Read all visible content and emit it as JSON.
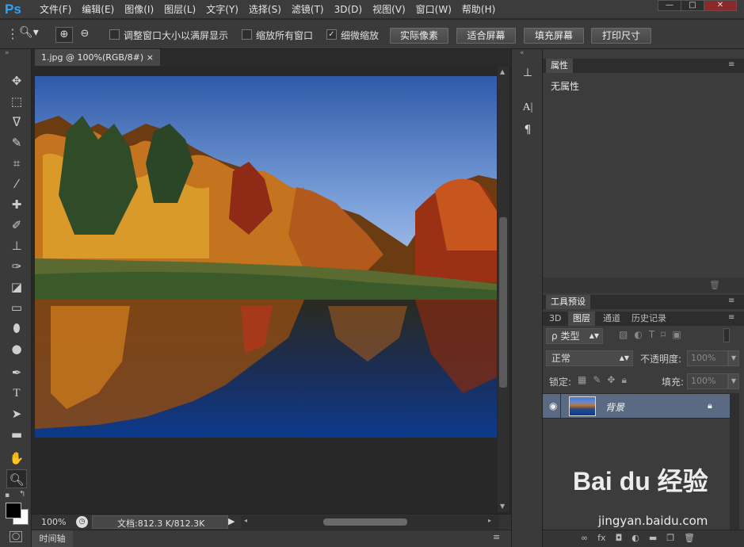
{
  "app": {
    "logo": "Ps"
  },
  "menu": [
    "文件(F)",
    "编辑(E)",
    "图像(I)",
    "图层(L)",
    "文字(Y)",
    "选择(S)",
    "滤镜(T)",
    "3D(D)",
    "视图(V)",
    "窗口(W)",
    "帮助(H)"
  ],
  "window_controls": {
    "minimize": "—",
    "restore": "□",
    "close": "✕"
  },
  "options": {
    "resize_windows": {
      "label": "调整窗口大小以满屏显示",
      "checked": false
    },
    "zoom_all": {
      "label": "缩放所有窗口",
      "checked": false
    },
    "scrubby_zoom": {
      "label": "细微缩放",
      "checked": true
    },
    "buttons": [
      "实际像素",
      "适合屏幕",
      "填充屏幕",
      "打印尺寸"
    ]
  },
  "document": {
    "tab_title": "1.jpg @ 100%(RGB/8#)",
    "tab_close": "×",
    "zoom": "100%",
    "doc_info": "文档:812.3 K/812.3K"
  },
  "timeline": {
    "label": "时间轴"
  },
  "properties": {
    "tab": "属性",
    "content": "无属性"
  },
  "tool_presets": {
    "tab": "工具预设"
  },
  "layers_panel": {
    "tabs": [
      "3D",
      "图层",
      "通道",
      "历史记录"
    ],
    "active_tab": "图层",
    "filter_kind": "类型",
    "blend_mode": "正常",
    "opacity_label": "不透明度:",
    "opacity_value": "100%",
    "lock_label": "锁定:",
    "fill_label": "填充:",
    "fill_value": "100%",
    "layers": [
      {
        "name": "背景",
        "visible": true,
        "locked": true
      }
    ]
  },
  "watermark": {
    "brand": "Bai du 经验",
    "url": "jingyan.baidu.com"
  },
  "colors": {
    "bg": "#282828",
    "panel": "#3c3c3c",
    "logo": "#2fa3f5",
    "selected_layer": "#5a6a82"
  }
}
